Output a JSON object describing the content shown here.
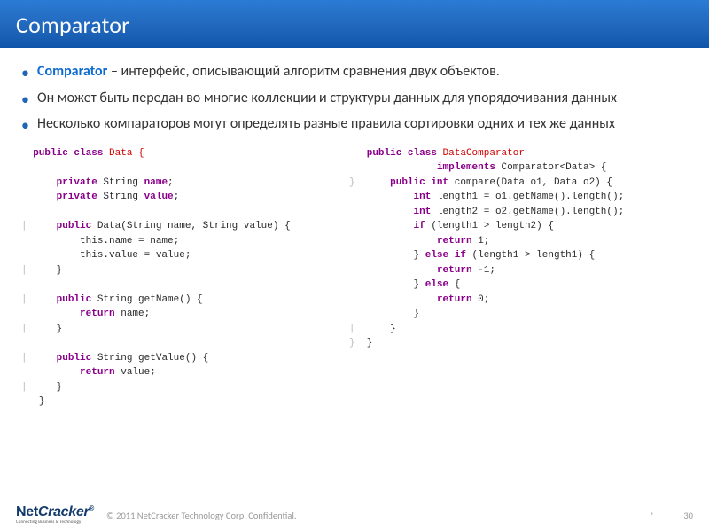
{
  "title": "Comparator",
  "bullets": [
    {
      "emph": "Comparator",
      "rest": " – интерфейс, описывающий алгоритм сравнения двух объектов."
    },
    {
      "emph": "",
      "rest": "Он может быть передан во многие  коллекции и структуры данных для упорядочивания данных"
    },
    {
      "emph": "",
      "rest": "Несколько компараторов могут определять разные правила сортировки одних и тех же данных"
    }
  ],
  "code_left": {
    "l1a": "public class",
    "l1b": " Data {",
    "l2a": "private",
    "l2b": " String ",
    "l2c": "name",
    "l2d": ";",
    "l3a": "private",
    "l3b": " String ",
    "l3c": "value",
    "l3d": ";",
    "l4a": "public",
    "l4b": " Data(String name, String value) {",
    "l5": "this.name = name;",
    "l6": "this.value = value;",
    "l7": "}",
    "l8a": "public",
    "l8b": " String getName() {",
    "l9a": "return",
    "l9b": " name;",
    "l10": "}",
    "l11a": "public",
    "l11b": " String getValue() {",
    "l12a": "return",
    "l12b": " value;",
    "l13": "}",
    "l14": "}"
  },
  "code_right": {
    "r1a": "public class",
    "r1b": " DataComparator",
    "r2a": "implements",
    "r2b": " Comparator<Data> {",
    "r3a": "public int",
    "r3b": " compare(Data o1, Data o2) {",
    "r4a": "int",
    "r4b": " length1 = o1.getName().length();",
    "r5a": "int",
    "r5b": " length2 = o2.getName().length();",
    "r6a": "if",
    "r6b": " (length1 > length2) {",
    "r7a": "return",
    "r7b": " 1;",
    "r8a": "} ",
    "r8b": "else if",
    "r8c": " (length1 > length1) {",
    "r9a": "return",
    "r9b": " -1;",
    "r10a": "} ",
    "r10b": "else",
    "r10c": " {",
    "r11a": "return",
    "r11b": " 0;",
    "r12": "}",
    "r13": "}",
    "r14": "}"
  },
  "footer": {
    "logo_main_a": "Net",
    "logo_main_b": "Cracker",
    "logo_reg": "®",
    "logo_sub": "Connecting Business & Technology",
    "copyright": "© 2011 NetCracker Technology Corp. Confidential.",
    "star": "*",
    "page": "30"
  }
}
